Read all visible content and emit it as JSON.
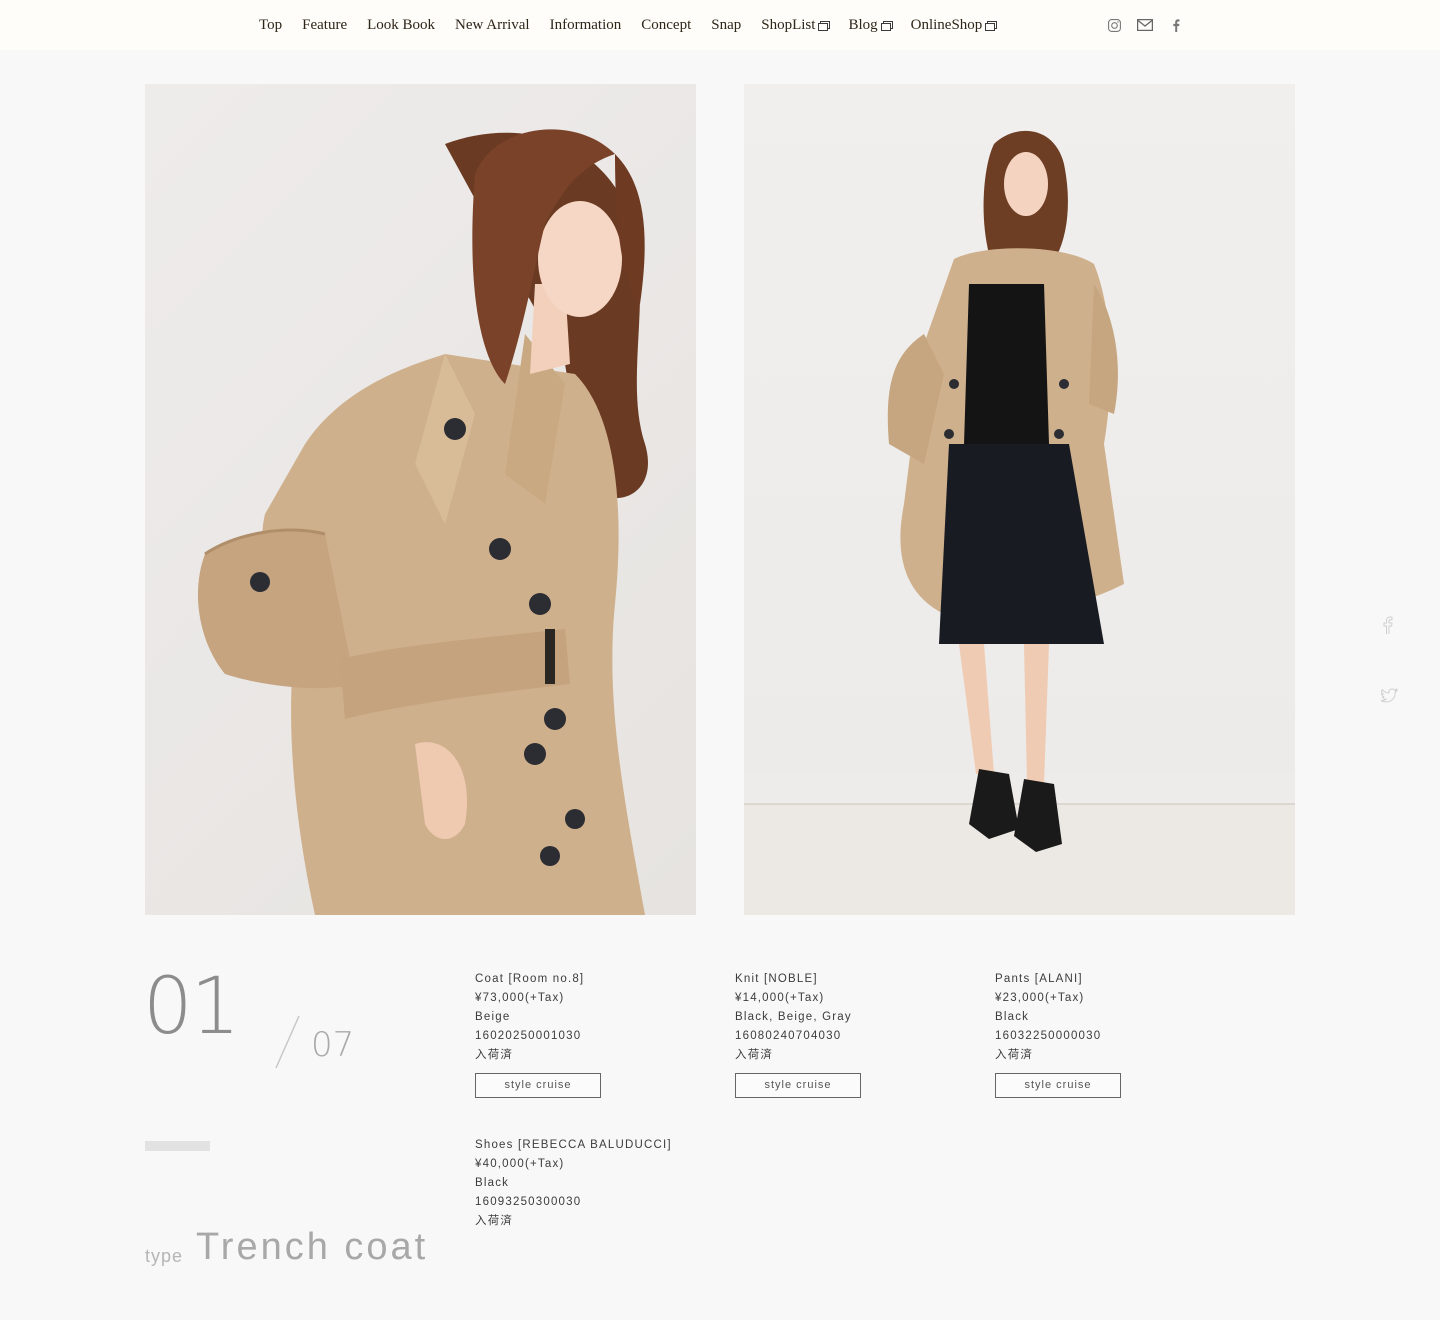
{
  "nav": [
    {
      "label": "Top",
      "external": false
    },
    {
      "label": "Feature",
      "external": false
    },
    {
      "label": "Look Book",
      "external": false
    },
    {
      "label": "New Arrival",
      "external": false
    },
    {
      "label": "Information",
      "external": false
    },
    {
      "label": "Concept",
      "external": false
    },
    {
      "label": "Snap",
      "external": false
    },
    {
      "label": "ShopList",
      "external": true
    },
    {
      "label": "Blog",
      "external": true
    },
    {
      "label": "OnlineShop",
      "external": true
    }
  ],
  "social_top": [
    "instagram-icon",
    "mail-icon",
    "facebook-icon"
  ],
  "look": {
    "number": "01",
    "total": "07",
    "type_label": "type",
    "type_value": "Trench coat"
  },
  "items": [
    {
      "name": "Coat [Room no.8]",
      "price": "¥73,000(+Tax)",
      "color": "Beige",
      "code": "16020250001030",
      "status": "入荷済",
      "button": "style cruise"
    },
    {
      "name": "Knit [NOBLE]",
      "price": "¥14,000(+Tax)",
      "color": "Black, Beige, Gray",
      "code": "16080240704030",
      "status": "入荷済",
      "button": "style cruise"
    },
    {
      "name": "Pants [ALANI]",
      "price": "¥23,000(+Tax)",
      "color": "Black",
      "code": "16032250000030",
      "status": "入荷済",
      "button": "style cruise"
    },
    {
      "name": "Shoes [REBECCA BALUDUCCI]",
      "price": "¥40,000(+Tax)",
      "color": "Black",
      "code": "16093250300030",
      "status": "入荷済",
      "button": ""
    }
  ],
  "side_share": [
    "facebook-share-icon",
    "twitter-share-icon"
  ],
  "colors": {
    "background": "#f8f8f8",
    "header": "#fffdf9",
    "coat": "#cfb08c",
    "text": "#3a3a3a"
  }
}
